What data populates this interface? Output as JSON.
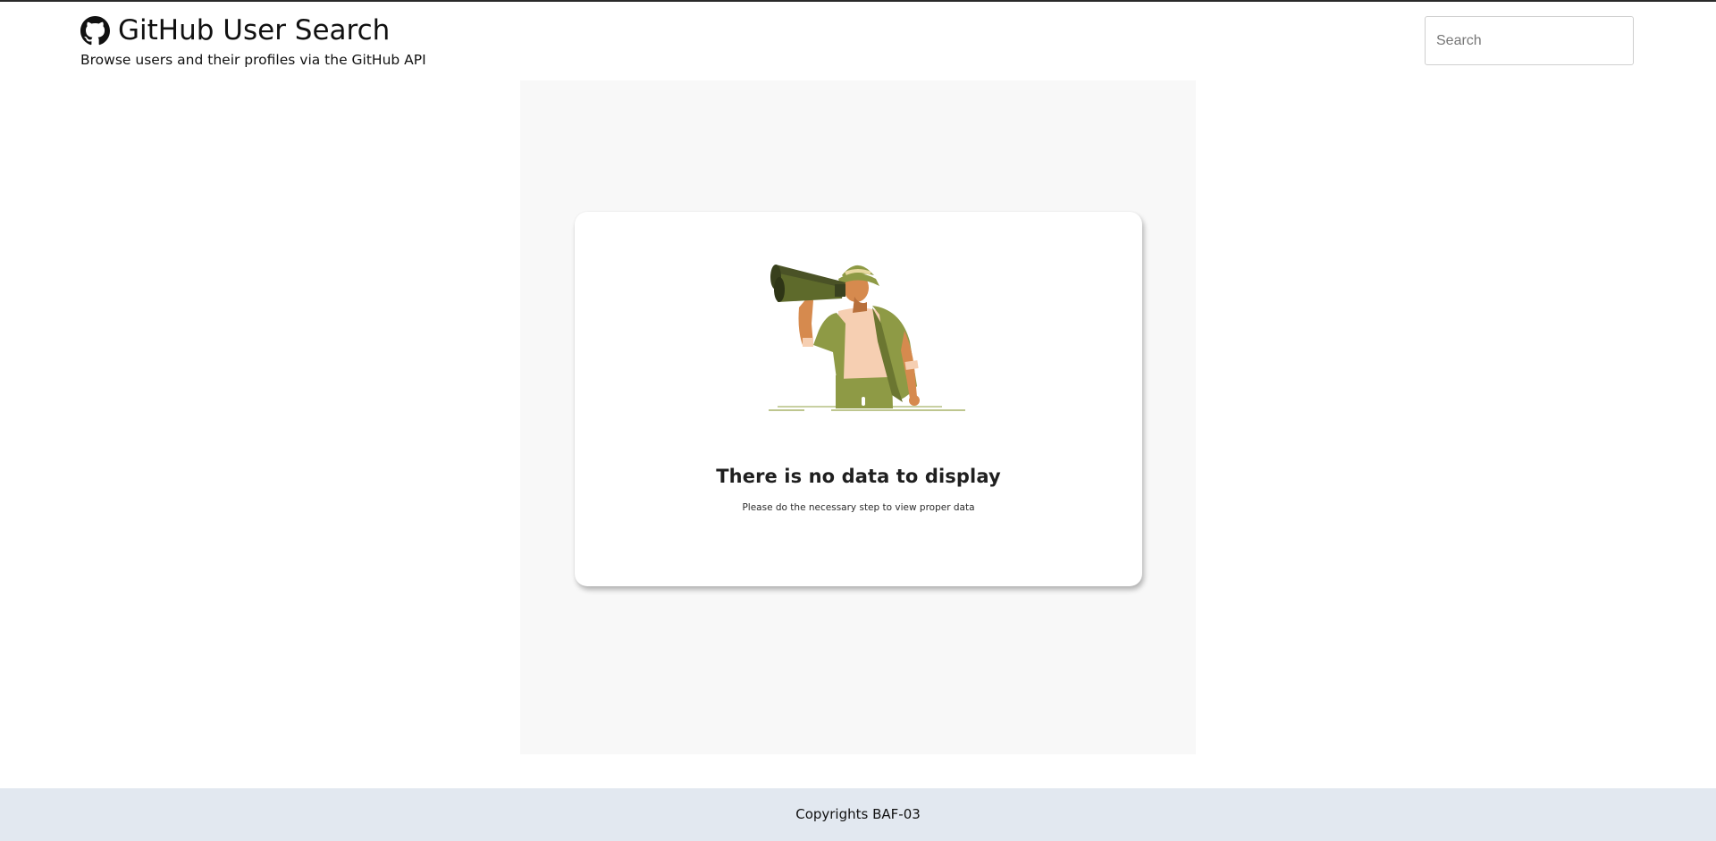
{
  "header": {
    "title": "GitHub User Search",
    "subtitle": "Browse users and their profiles via the GitHub API",
    "logo_icon": "github-icon"
  },
  "search": {
    "placeholder": "Search",
    "value": ""
  },
  "empty_state": {
    "illustration": "man-with-binoculars-illustration",
    "title": "There is no data to display",
    "description": "Please do the necessary step to view proper data"
  },
  "footer": {
    "text": "Copyrights BAF-03"
  },
  "colors": {
    "footer_background": "#e2e8f0",
    "panel_background": "#f8f8f8",
    "illustration_green": "#8e9a45",
    "illustration_dark_green": "#5e6a2b",
    "illustration_skin": "#d68a4e"
  }
}
